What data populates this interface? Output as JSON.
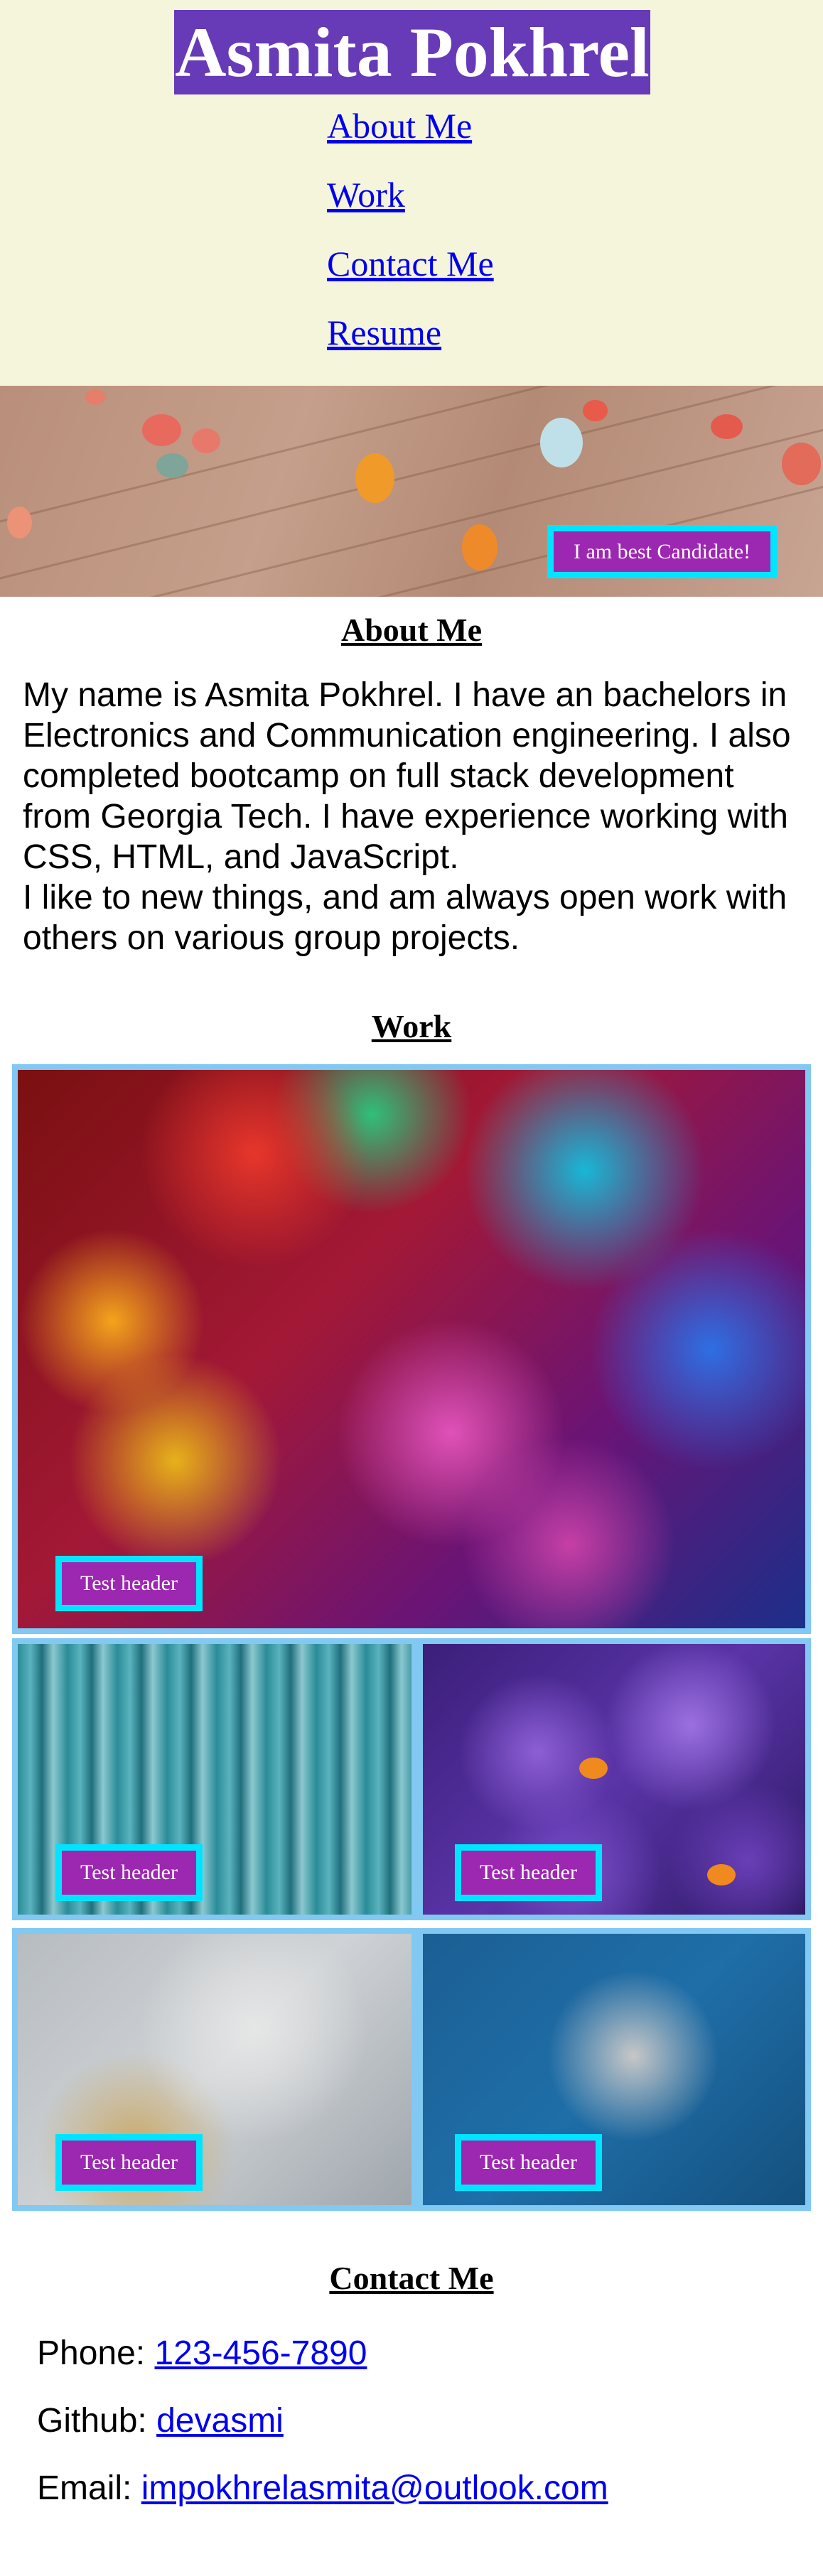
{
  "header": {
    "title": "Asmita Pokhrel",
    "nav": [
      "About Me",
      "Work",
      "Contact Me",
      "Resume"
    ]
  },
  "hero": {
    "badge": "I am best Candidate!"
  },
  "about": {
    "heading": "About Me",
    "paragraph1": "My name is Asmita Pokhrel. I have an bachelors in Electronics and Communication engineering. I also completed bootcamp on full stack development from Georgia Tech. I have experience working with CSS, HTML, and JavaScript.",
    "paragraph2": "I like to new things, and am always open work with others on various group projects."
  },
  "work": {
    "heading": "Work",
    "tiles": [
      {
        "label": "Test header"
      },
      {
        "label": "Test header"
      },
      {
        "label": "Test header"
      },
      {
        "label": "Test header"
      },
      {
        "label": "Test header"
      }
    ]
  },
  "contact": {
    "heading": "Contact Me",
    "phone_label": "Phone:",
    "phone": "123-456-7890",
    "github_label": "Github:",
    "github": "devasmi",
    "email_label": "Email:",
    "email": "impokhrelasmita@outlook.com"
  },
  "colors": {
    "header_bg": "#f5f5dc",
    "title_bg": "#673ab7",
    "badge_bg": "#9c27b0",
    "badge_border": "#00e5ff",
    "frame": "#81c9f2",
    "link": "#0000ee"
  }
}
